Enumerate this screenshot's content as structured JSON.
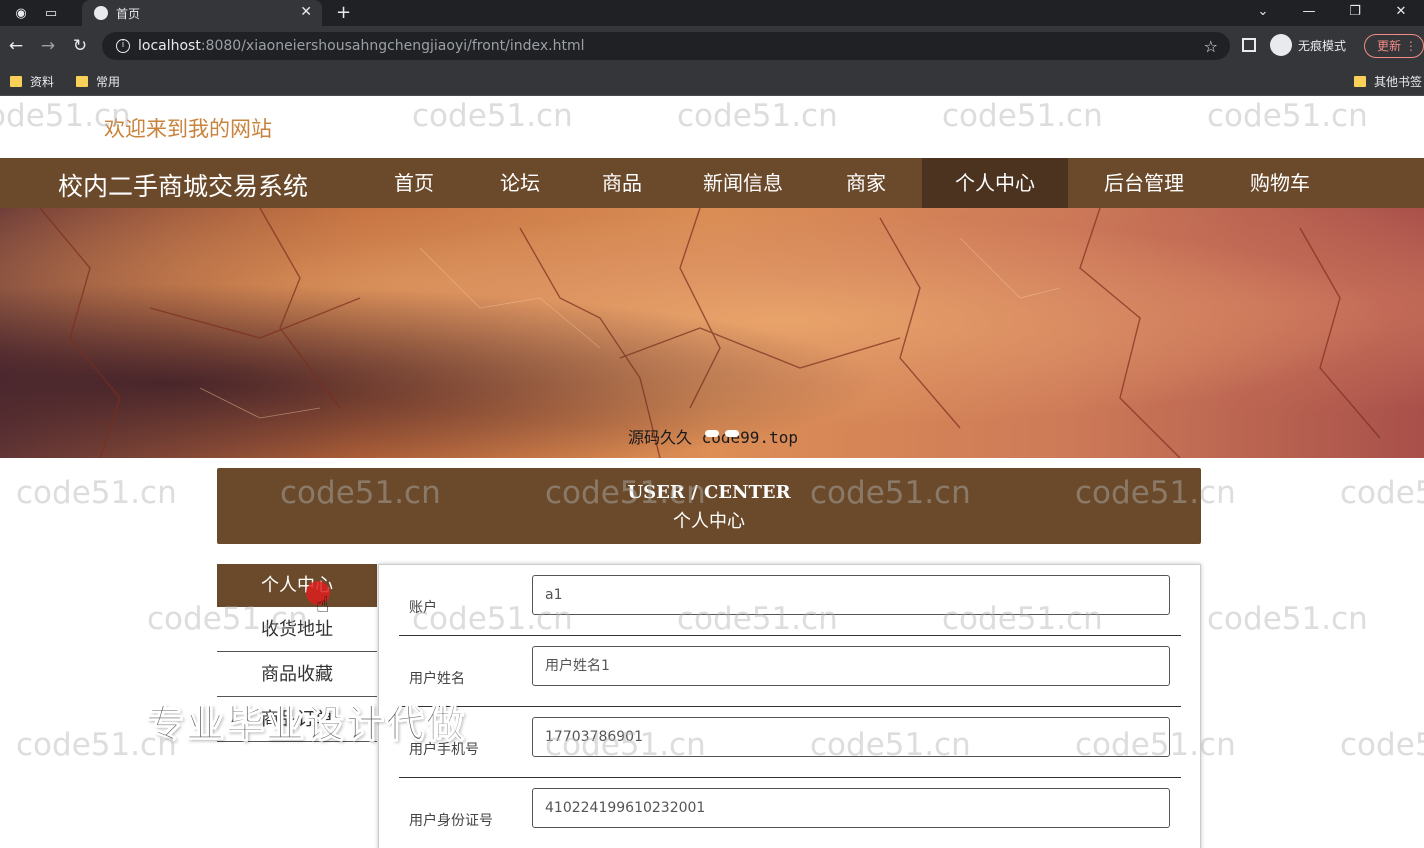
{
  "browser": {
    "tab_title": "首页",
    "url_host": "localhost",
    "url_rest": ":8080/xiaoneiershousahngchengjiaoyi/front/index.html",
    "incognito_label": "无痕模式",
    "update_label": "更新",
    "bookmarks": [
      "资料",
      "常用"
    ],
    "other_bookmarks": "其他书签"
  },
  "site": {
    "welcome": "欢迎来到我的网站",
    "brand": "校内二手商城交易系统",
    "nav": [
      "首页",
      "论坛",
      "商品",
      "新闻信息",
      "商家",
      "个人中心",
      "后台管理",
      "购物车"
    ],
    "active_nav_index": 5,
    "banner_caption": "源码久久 code99.top",
    "watermark": "code51.cn",
    "promo": "专业毕业设计代做"
  },
  "section": {
    "title_en": "USER / CENTER",
    "title_cn": "个人中心"
  },
  "sidebar": {
    "items": [
      "个人中心",
      "收货地址",
      "商品收藏",
      "商品订单"
    ],
    "active_index": 0
  },
  "form": {
    "fields": [
      {
        "label": "账户",
        "value": "a1"
      },
      {
        "label": "用户姓名",
        "value": "用户姓名1"
      },
      {
        "label": "用户手机号",
        "value": "17703786901"
      },
      {
        "label": "用户身份证号",
        "value": "410224199610232001"
      }
    ]
  },
  "colors": {
    "brand_brown": "#6b4a2b",
    "active_brown": "#4b3320",
    "welcome_orange": "#c8833c"
  }
}
